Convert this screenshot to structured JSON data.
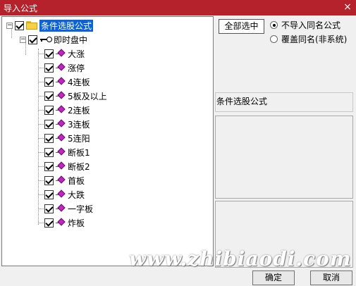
{
  "window": {
    "title": "导入公式",
    "close_glyph": "×"
  },
  "tree": {
    "root_label": "条件选股公式",
    "group_label": "即时盘中",
    "items": [
      "大涨",
      "涨停",
      "4连板",
      "5板及以上",
      "2连板",
      "3连板",
      "5连阳",
      "断板1",
      "断板2",
      "首板",
      "大跌",
      "一字板",
      "炸板"
    ]
  },
  "options": {
    "select_all_label": "全部选中",
    "radio_no_import": "不导入同名公式",
    "radio_overwrite": "覆盖同名(非系统)"
  },
  "detail": {
    "category_label": "条件选股公式"
  },
  "footer": {
    "ok_label": "确定",
    "cancel_label": "取消"
  },
  "watermark": "www.zhibiaodi.com",
  "colors": {
    "titlebar": "#b5222b",
    "selection": "#0a64d8",
    "formula_icon": "#c026c0"
  }
}
